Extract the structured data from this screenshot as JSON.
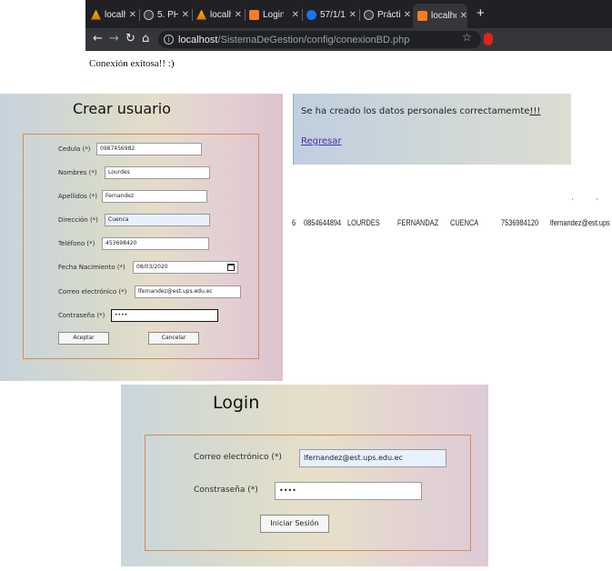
{
  "browser": {
    "tabs": [
      {
        "label": "localhos",
        "icon": "xampp-icon"
      },
      {
        "label": "5. PHP:",
        "icon": "globe-icon"
      },
      {
        "label": "localhos",
        "icon": "xampp-icon"
      },
      {
        "label": "Login",
        "icon": "xampp-logo-icon"
      },
      {
        "label": "57/1/1:",
        "icon": "ups-icon"
      },
      {
        "label": "Práctic",
        "icon": "globe-icon"
      },
      {
        "label": "localhos",
        "icon": "xampp-logo-icon",
        "active": true
      }
    ],
    "new_tab": "+",
    "url_host": "localhost",
    "url_path": "/SistemaDeGestion/config/conexionBD.php",
    "page_message": "Conexión exitosa!! :)"
  },
  "crear_usuario": {
    "title": "Crear usuario",
    "fields": [
      {
        "label": "Cedula (*)",
        "value": "0987456982"
      },
      {
        "label": "Nombres (*)",
        "value": "Lourdes"
      },
      {
        "label": "Apellidos (*)",
        "value": "Fernandez"
      },
      {
        "label": "Dirección (*)",
        "value": "Cuenca"
      },
      {
        "label": "Teléfono (*)",
        "value": "453698420"
      },
      {
        "label": "Fecha Nacimiento (*)",
        "value": "08/03/2020"
      },
      {
        "label": "Correo electrónico (*)",
        "value": "lfernandez@est.ups.edu.ec"
      },
      {
        "label": "Contraseña (*)",
        "value": "••••"
      }
    ],
    "accept_label": "Aceptar",
    "cancel_label": "Cancelar"
  },
  "success_panel": {
    "message": "Se ha creado los datos personales correctamemte",
    "message_suffix": "!!!",
    "back_link": "Regresar"
  },
  "data_row": {
    "id": "6",
    "cedula": "0854644894",
    "nombres": "LOURDES",
    "apellidos": "FERNANDAZ",
    "direccion": "CUENCA",
    "telefono": "7536984120",
    "correo": "lfernandez@est.ups"
  },
  "login": {
    "title": "Login",
    "email_label": "Correo electrónico (*)",
    "email_value": "lfernandez@est.ups.edu.ec",
    "password_label": "Constraseña (*)",
    "password_value": "••••",
    "submit_label": "Iniciar Sesión"
  },
  "colors": {
    "form_border": "#d98a56",
    "link": "#4b2fa8",
    "chrome_dark": "#202124"
  }
}
